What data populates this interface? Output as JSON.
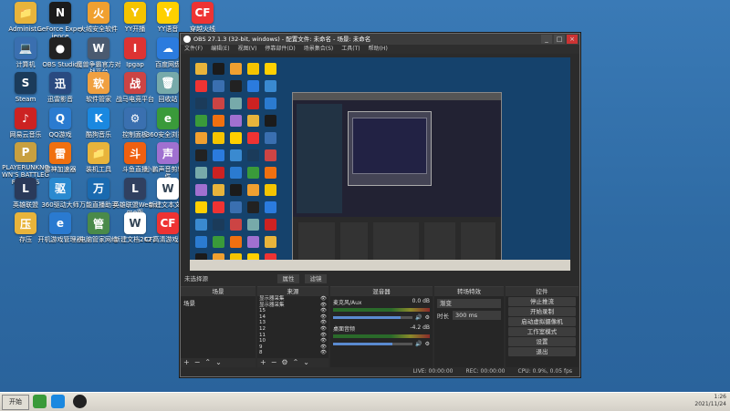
{
  "colors": {
    "desktop": "#2f6ea8",
    "obs_bg": "#2b2b2b",
    "accent": "#3c3c3c"
  },
  "desktop_icons": [
    {
      "label": "Administ...",
      "color": "#e8b43b",
      "glyph": "📁"
    },
    {
      "label": "GeForce Experience",
      "color": "#1b1b1b",
      "glyph": "N"
    },
    {
      "label": "火绒安全软件",
      "color": "#f0a030",
      "glyph": "火"
    },
    {
      "label": "YY开播",
      "color": "#f5c400",
      "glyph": "Y"
    },
    {
      "label": "YY语音",
      "color": "#ffd000",
      "glyph": "Y"
    },
    {
      "label": "穿越火线",
      "color": "#e33",
      "glyph": "CF"
    },
    {
      "label": "计算机",
      "color": "#3a6fb0",
      "glyph": "💻"
    },
    {
      "label": "OBS Studio",
      "color": "#222",
      "glyph": "●"
    },
    {
      "label": "魔兽争霸官方对战平台",
      "color": "#4a5a70",
      "glyph": "W"
    },
    {
      "label": "Ipgap",
      "color": "#d33",
      "glyph": "I"
    },
    {
      "label": "百度网盘",
      "color": "#2b7bde",
      "glyph": "☁"
    },
    {
      "label": "网络",
      "color": "#3a8ad0",
      "glyph": "🌐"
    },
    {
      "label": "Steam",
      "color": "#1b3b5a",
      "glyph": "S"
    },
    {
      "label": "迅雷影音",
      "color": "#2a4a80",
      "glyph": "迅"
    },
    {
      "label": "软件管家",
      "color": "#f0a040",
      "glyph": "软"
    },
    {
      "label": "战马电竞平台",
      "color": "#c44",
      "glyph": "战"
    },
    {
      "label": "回收站",
      "color": "#7aa",
      "glyph": "🗑"
    },
    {
      "label": "NeGame",
      "color": "#2a2a2a",
      "glyph": "N"
    },
    {
      "label": "网易云音乐",
      "color": "#c22",
      "glyph": "♪"
    },
    {
      "label": "QQ游戏",
      "color": "#2b7bd0",
      "glyph": "Q"
    },
    {
      "label": "酷狗音乐",
      "color": "#1a88e0",
      "glyph": "K"
    },
    {
      "label": "控制面板",
      "color": "#3a70b0",
      "glyph": "⚙"
    },
    {
      "label": "360安全浏览器",
      "color": "#3a9a3a",
      "glyph": "e"
    },
    {
      "label": "腾讯QQ",
      "color": "#1a1a1a",
      "glyph": "Q"
    },
    {
      "label": "PLAYERUNKNOWN'S BATTLEGROUNDS",
      "color": "#c8a040",
      "glyph": "P"
    },
    {
      "label": "雷神加速器",
      "color": "#f07010",
      "glyph": "雷"
    },
    {
      "label": "装机工具",
      "color": "#e8b43b",
      "glyph": "📁"
    },
    {
      "label": "斗鱼直播",
      "color": "#f06010",
      "glyph": "斗"
    },
    {
      "label": "小鹏声音剪辑软件",
      "color": "#a070d0",
      "glyph": "声"
    },
    {
      "label": "永劫无间",
      "color": "#d04040",
      "glyph": "永"
    },
    {
      "label": "英雄联盟",
      "color": "#2a3a5a",
      "glyph": "L"
    },
    {
      "label": "360驱动大师",
      "color": "#2a8ad0",
      "glyph": "驱"
    },
    {
      "label": "万能直播助手",
      "color": "#1a6ab0",
      "glyph": "万"
    },
    {
      "label": "英雄联盟WeGame版",
      "color": "#304060",
      "glyph": "L"
    },
    {
      "label": "新建文本文档",
      "color": "#fff",
      "glyph": "W"
    },
    {
      "label": "金之盛OBS工具",
      "color": "#fff",
      "glyph": "▣"
    },
    {
      "label": "存压",
      "color": "#e8b43b",
      "glyph": "压"
    },
    {
      "label": "开机游戏管理器",
      "color": "#2a7ad0",
      "glyph": "e"
    },
    {
      "label": "电脑管家网络",
      "color": "#4a8a4a",
      "glyph": "管"
    },
    {
      "label": "新建文档2021",
      "color": "#fff",
      "glyph": "W"
    },
    {
      "label": "CF高清游戏大区",
      "color": "#e33",
      "glyph": "CF"
    }
  ],
  "obs": {
    "title": "OBS 27.1.3 (32-bit, windows) - 配置文件: 未命名 - 场景: 未命名",
    "window_controls": [
      "_",
      "□",
      "×"
    ],
    "menu": [
      "文件(F)",
      "编辑(E)",
      "视图(V)",
      "停靠部件(D)",
      "场景集合(S)",
      "工具(T)",
      "帮助(H)"
    ],
    "source_status": "未选择源",
    "props_label": "属性",
    "filters_label": "滤镜",
    "scenes": {
      "header": "场景",
      "items": [
        "场景"
      ]
    },
    "sources": {
      "header": "来源",
      "items": [
        "显示器采集",
        "显示器采集",
        "15",
        "14",
        "13",
        "12",
        "11",
        "10",
        "9",
        "8"
      ]
    },
    "mixer": {
      "header": "混音器",
      "channels": [
        {
          "name": "麦克风/Aux",
          "db": "0.0 dB",
          "level": 0.85
        },
        {
          "name": "桌面音频",
          "db": "-4.2 dB",
          "level": 0.75
        }
      ]
    },
    "transitions": {
      "header": "转场特效",
      "type": "渐变",
      "duration_label": "时长",
      "duration": "300 ms"
    },
    "controls": {
      "header": "控件",
      "buttons": [
        "停止推流",
        "开始录制",
        "启动虚拟摄像机",
        "工作室模式",
        "设置",
        "退出"
      ]
    },
    "status": {
      "live": "LIVE: 00:00:00",
      "rec": "REC: 00:00:00",
      "cpu": "CPU: 0.9%, 0.05 fps"
    }
  },
  "taskbar": {
    "start": "开始",
    "time": "1:26",
    "date": "2021/11/24"
  }
}
